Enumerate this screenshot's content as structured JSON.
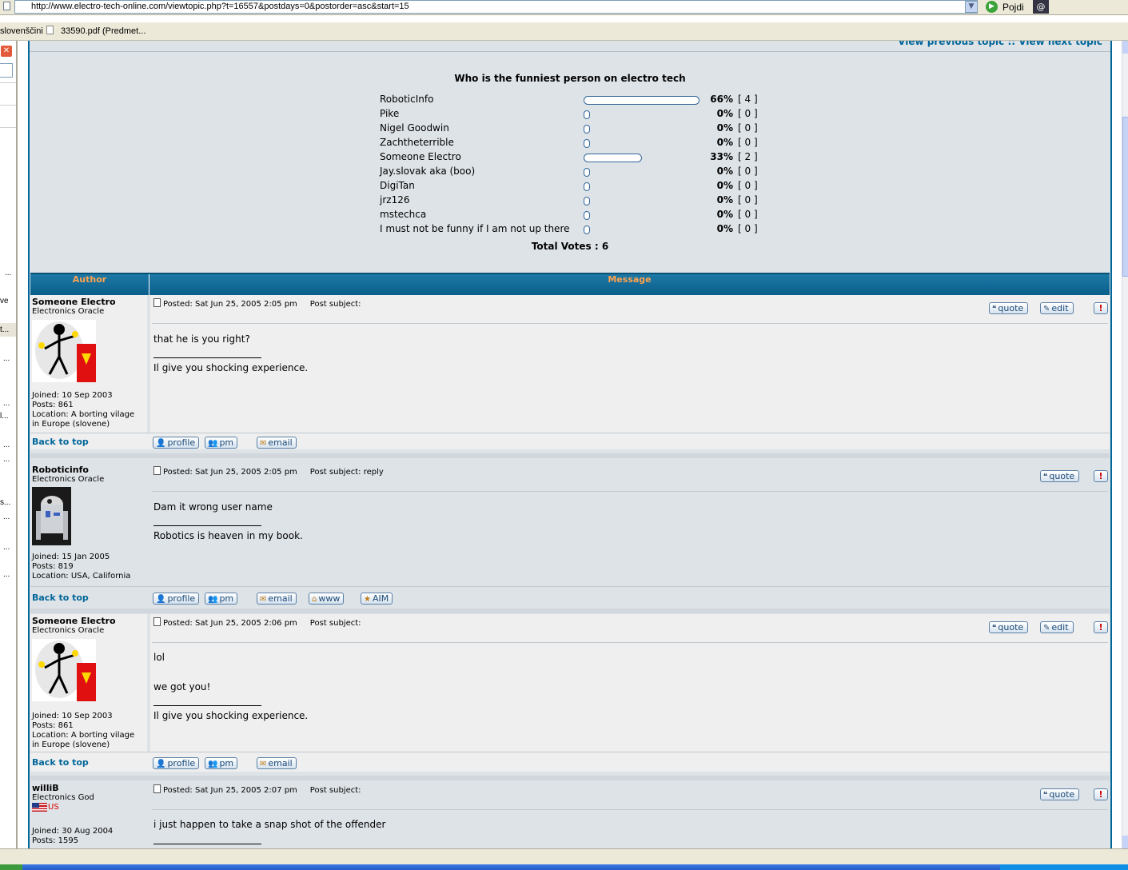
{
  "browser": {
    "url": "http://www.electro-tech-online.com/viewtopic.php?t=16557&postdays=0&postorder=asc&start=15",
    "go_label": "Pojdi",
    "bookmarks": [
      "slovenščini",
      "33590.pdf (Predmet..."
    ]
  },
  "sidepanel": {
    "items": [
      "...",
      "ve",
      "t...",
      "...",
      "...",
      "l...",
      "...",
      "...",
      "s...",
      "...",
      "...",
      "..."
    ]
  },
  "topic_nav": {
    "prev": "View previous topic",
    "separator": "::",
    "next": "View next topic"
  },
  "poll": {
    "title": "Who is the funniest person on electro tech",
    "options": [
      {
        "name": "RoboticInfo",
        "percent": 66,
        "pct_label": "66%",
        "count_label": "[ 4 ]"
      },
      {
        "name": "Pike",
        "percent": 0,
        "pct_label": "0%",
        "count_label": "[ 0 ]"
      },
      {
        "name": "Nigel Goodwin",
        "percent": 0,
        "pct_label": "0%",
        "count_label": "[ 0 ]"
      },
      {
        "name": "Zachtheterrible",
        "percent": 0,
        "pct_label": "0%",
        "count_label": "[ 0 ]"
      },
      {
        "name": "Someone Electro",
        "percent": 33,
        "pct_label": "33%",
        "count_label": "[ 2 ]"
      },
      {
        "name": "Jay.slovak aka (boo)",
        "percent": 0,
        "pct_label": "0%",
        "count_label": "[ 0 ]"
      },
      {
        "name": "DigiTan",
        "percent": 0,
        "pct_label": "0%",
        "count_label": "[ 0 ]"
      },
      {
        "name": "jrz126",
        "percent": 0,
        "pct_label": "0%",
        "count_label": "[ 0 ]"
      },
      {
        "name": "mstechca",
        "percent": 0,
        "pct_label": "0%",
        "count_label": "[ 0 ]"
      },
      {
        "name": "I must not be funny if I am not up there",
        "percent": 0,
        "pct_label": "0%",
        "count_label": "[ 0 ]"
      }
    ],
    "total": "Total Votes : 6"
  },
  "table_header": {
    "author": "Author",
    "message": "Message"
  },
  "labels": {
    "back_to_top": "Back to top",
    "quote": "quote",
    "edit": "edit",
    "report": "!",
    "profile": "profile",
    "pm": "pm",
    "email": "email",
    "www": "www",
    "aim": "AIM",
    "post_subject": "Post subject:"
  },
  "posts": [
    {
      "author": "Someone Electro",
      "rank": "Electronics Oracle",
      "joined": "Joined: 10 Sep 2003",
      "posts": "Posts: 861",
      "location": "Location: A borting vilage",
      "location2": "in Europe (slovene)",
      "posted": "Posted: Sat Jun 25, 2005 2:05 pm",
      "subject": "",
      "lines": [
        "that he is you right?"
      ],
      "signature": "Il give you shocking experience."
    },
    {
      "author": "Roboticinfo",
      "rank": "Electronics Oracle",
      "joined": "Joined: 15 Jan 2005",
      "posts": "Posts: 819",
      "location": "Location: USA, California",
      "posted": "Posted: Sat Jun 25, 2005 2:05 pm",
      "subject": "reply",
      "lines": [
        "Dam it wrong user name"
      ],
      "signature": "Robotics is heaven in my book."
    },
    {
      "author": "Someone Electro",
      "rank": "Electronics Oracle",
      "joined": "Joined: 10 Sep 2003",
      "posts": "Posts: 861",
      "location": "Location: A borting vilage",
      "location2": "in Europe (slovene)",
      "posted": "Posted: Sat Jun 25, 2005 2:06 pm",
      "subject": "",
      "lines": [
        "lol",
        "we got you!"
      ],
      "signature": "Il give you shocking experience."
    },
    {
      "author": "williB",
      "rank": "Electronics God",
      "flag_label": "US",
      "joined": "Joined: 30 Aug 2004",
      "posts": "Posts: 1595",
      "posted": "Posted: Sat Jun 25, 2005 2:07 pm",
      "subject": "",
      "lines": [
        "i just happen to take a snap shot of the offender"
      ]
    }
  ]
}
